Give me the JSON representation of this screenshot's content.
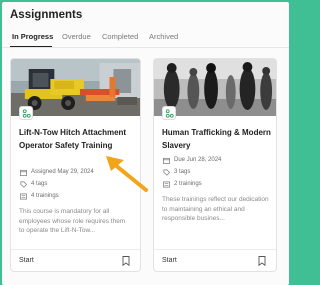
{
  "page": {
    "title": "Assignments"
  },
  "tabs": [
    {
      "label": "In Progress",
      "active": true
    },
    {
      "label": "Overdue",
      "active": false
    },
    {
      "label": "Completed",
      "active": false
    },
    {
      "label": "Archived",
      "active": false
    }
  ],
  "cards": [
    {
      "title": "Lift-N-Tow Hitch Attachment Operator Safety Training",
      "date_label": "Assigned May 29, 2024",
      "tags_label": "4 tags",
      "trainings_label": "4 trainings",
      "description": "This course is mandatory for all employees whose role requires them to operate the Lift-N-Tow...",
      "start_label": "Start",
      "icons": {
        "badge": "learning-path-icon",
        "date": "calendar-icon",
        "tags": "tag-icon",
        "trainings": "training-icon",
        "save": "bookmark-icon"
      }
    },
    {
      "title": "Human Trafficking & Modern Slavery",
      "date_label": "Due Jun 28, 2024",
      "tags_label": "3 tags",
      "trainings_label": "2 trainings",
      "description": "These trainings reflect our dedication to maintaining an ethical and responsible busines...",
      "start_label": "Start",
      "icons": {
        "badge": "learning-path-icon",
        "date": "calendar-icon",
        "tags": "tag-icon",
        "trainings": "training-icon",
        "save": "bookmark-icon"
      }
    }
  ],
  "colors": {
    "background": "#3fbf93",
    "badge": "#2a9d5c",
    "arrow": "#f2a51a"
  }
}
